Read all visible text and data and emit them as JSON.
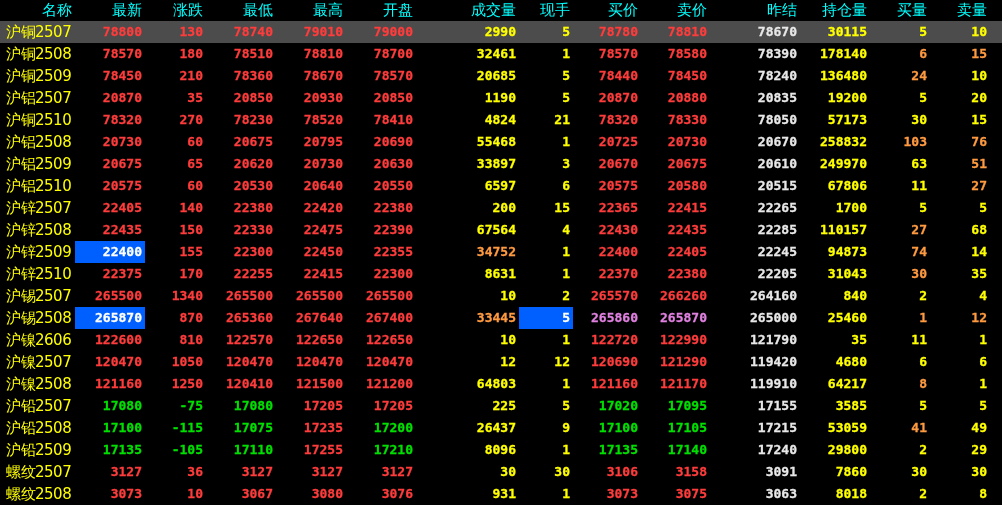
{
  "columns": [
    "名称",
    "最新",
    "涨跌",
    "最低",
    "最高",
    "开盘",
    "成交量",
    "现手",
    "买价",
    "卖价",
    "昨结",
    "持仓量",
    "买量",
    "卖量"
  ],
  "rows": [
    {
      "name": "沪铜2507",
      "selected": true,
      "cells": [
        {
          "text": "78800",
          "color": "#ff3c3c",
          "flash": false
        },
        {
          "text": "130",
          "color": "#ff3c3c",
          "flash": false
        },
        {
          "text": "78740",
          "color": "#ff3c3c",
          "flash": false
        },
        {
          "text": "79010",
          "color": "#ff3c3c",
          "flash": false
        },
        {
          "text": "79000",
          "color": "#ff3c3c",
          "flash": false
        },
        {
          "text": "2990",
          "color": "#ffff00",
          "flash": false
        },
        {
          "text": "5",
          "color": "#ffff00",
          "flash": false
        },
        {
          "text": "78780",
          "color": "#ff3c3c",
          "flash": false
        },
        {
          "text": "78810",
          "color": "#ff3c3c",
          "flash": false
        },
        {
          "text": "78670",
          "color": "#e8e8e8",
          "flash": false
        },
        {
          "text": "30115",
          "color": "#ffff00",
          "flash": false
        },
        {
          "text": "5",
          "color": "#ffff00",
          "flash": false
        },
        {
          "text": "10",
          "color": "#ffff00",
          "flash": false
        }
      ]
    },
    {
      "name": "沪铜2508",
      "selected": false,
      "cells": [
        {
          "text": "78570",
          "color": "#ff3c3c",
          "flash": false
        },
        {
          "text": "180",
          "color": "#ff3c3c",
          "flash": false
        },
        {
          "text": "78510",
          "color": "#ff3c3c",
          "flash": false
        },
        {
          "text": "78810",
          "color": "#ff3c3c",
          "flash": false
        },
        {
          "text": "78700",
          "color": "#ff3c3c",
          "flash": false
        },
        {
          "text": "32461",
          "color": "#ffff00",
          "flash": false
        },
        {
          "text": "1",
          "color": "#ffff00",
          "flash": false
        },
        {
          "text": "78570",
          "color": "#ff3c3c",
          "flash": false
        },
        {
          "text": "78580",
          "color": "#ff3c3c",
          "flash": false
        },
        {
          "text": "78390",
          "color": "#e8e8e8",
          "flash": false
        },
        {
          "text": "178140",
          "color": "#ffff00",
          "flash": false
        },
        {
          "text": "6",
          "color": "#ff9a40",
          "flash": false
        },
        {
          "text": "15",
          "color": "#ff9a40",
          "flash": false
        }
      ]
    },
    {
      "name": "沪铜2509",
      "selected": false,
      "cells": [
        {
          "text": "78450",
          "color": "#ff3c3c",
          "flash": false
        },
        {
          "text": "210",
          "color": "#ff3c3c",
          "flash": false
        },
        {
          "text": "78360",
          "color": "#ff3c3c",
          "flash": false
        },
        {
          "text": "78670",
          "color": "#ff3c3c",
          "flash": false
        },
        {
          "text": "78570",
          "color": "#ff3c3c",
          "flash": false
        },
        {
          "text": "20685",
          "color": "#ffff00",
          "flash": false
        },
        {
          "text": "5",
          "color": "#ffff00",
          "flash": false
        },
        {
          "text": "78440",
          "color": "#ff3c3c",
          "flash": false
        },
        {
          "text": "78450",
          "color": "#ff3c3c",
          "flash": false
        },
        {
          "text": "78240",
          "color": "#e8e8e8",
          "flash": false
        },
        {
          "text": "136480",
          "color": "#ffff00",
          "flash": false
        },
        {
          "text": "24",
          "color": "#ff9a40",
          "flash": false
        },
        {
          "text": "10",
          "color": "#ffff00",
          "flash": false
        }
      ]
    },
    {
      "name": "沪铝2507",
      "selected": false,
      "cells": [
        {
          "text": "20870",
          "color": "#ff3c3c",
          "flash": false
        },
        {
          "text": "35",
          "color": "#ff3c3c",
          "flash": false
        },
        {
          "text": "20850",
          "color": "#ff3c3c",
          "flash": false
        },
        {
          "text": "20930",
          "color": "#ff3c3c",
          "flash": false
        },
        {
          "text": "20850",
          "color": "#ff3c3c",
          "flash": false
        },
        {
          "text": "1190",
          "color": "#ffff00",
          "flash": false
        },
        {
          "text": "5",
          "color": "#ffff00",
          "flash": false
        },
        {
          "text": "20870",
          "color": "#ff3c3c",
          "flash": false
        },
        {
          "text": "20880",
          "color": "#ff3c3c",
          "flash": false
        },
        {
          "text": "20835",
          "color": "#e8e8e8",
          "flash": false
        },
        {
          "text": "19200",
          "color": "#ffff00",
          "flash": false
        },
        {
          "text": "5",
          "color": "#ffff00",
          "flash": false
        },
        {
          "text": "20",
          "color": "#ffff00",
          "flash": false
        }
      ]
    },
    {
      "name": "沪铜2510",
      "selected": false,
      "cells": [
        {
          "text": "78320",
          "color": "#ff3c3c",
          "flash": false
        },
        {
          "text": "270",
          "color": "#ff3c3c",
          "flash": false
        },
        {
          "text": "78230",
          "color": "#ff3c3c",
          "flash": false
        },
        {
          "text": "78520",
          "color": "#ff3c3c",
          "flash": false
        },
        {
          "text": "78410",
          "color": "#ff3c3c",
          "flash": false
        },
        {
          "text": "4824",
          "color": "#ffff00",
          "flash": false
        },
        {
          "text": "21",
          "color": "#ffff00",
          "flash": false
        },
        {
          "text": "78320",
          "color": "#ff3c3c",
          "flash": false
        },
        {
          "text": "78330",
          "color": "#ff3c3c",
          "flash": false
        },
        {
          "text": "78050",
          "color": "#e8e8e8",
          "flash": false
        },
        {
          "text": "57173",
          "color": "#ffff00",
          "flash": false
        },
        {
          "text": "30",
          "color": "#ffff00",
          "flash": false
        },
        {
          "text": "15",
          "color": "#ffff00",
          "flash": false
        }
      ]
    },
    {
      "name": "沪铝2508",
      "selected": false,
      "cells": [
        {
          "text": "20730",
          "color": "#ff3c3c",
          "flash": false
        },
        {
          "text": "60",
          "color": "#ff3c3c",
          "flash": false
        },
        {
          "text": "20675",
          "color": "#ff3c3c",
          "flash": false
        },
        {
          "text": "20795",
          "color": "#ff3c3c",
          "flash": false
        },
        {
          "text": "20690",
          "color": "#ff3c3c",
          "flash": false
        },
        {
          "text": "55468",
          "color": "#ffff00",
          "flash": false
        },
        {
          "text": "1",
          "color": "#ffff00",
          "flash": false
        },
        {
          "text": "20725",
          "color": "#ff3c3c",
          "flash": false
        },
        {
          "text": "20730",
          "color": "#ff3c3c",
          "flash": false
        },
        {
          "text": "20670",
          "color": "#e8e8e8",
          "flash": false
        },
        {
          "text": "258832",
          "color": "#ffff00",
          "flash": false
        },
        {
          "text": "103",
          "color": "#ff9a40",
          "flash": false
        },
        {
          "text": "76",
          "color": "#ff9a40",
          "flash": false
        }
      ]
    },
    {
      "name": "沪铝2509",
      "selected": false,
      "cells": [
        {
          "text": "20675",
          "color": "#ff3c3c",
          "flash": false
        },
        {
          "text": "65",
          "color": "#ff3c3c",
          "flash": false
        },
        {
          "text": "20620",
          "color": "#ff3c3c",
          "flash": false
        },
        {
          "text": "20730",
          "color": "#ff3c3c",
          "flash": false
        },
        {
          "text": "20630",
          "color": "#ff3c3c",
          "flash": false
        },
        {
          "text": "33897",
          "color": "#ffff00",
          "flash": false
        },
        {
          "text": "3",
          "color": "#ffff00",
          "flash": false
        },
        {
          "text": "20670",
          "color": "#ff3c3c",
          "flash": false
        },
        {
          "text": "20675",
          "color": "#ff3c3c",
          "flash": false
        },
        {
          "text": "20610",
          "color": "#e8e8e8",
          "flash": false
        },
        {
          "text": "249970",
          "color": "#ffff00",
          "flash": false
        },
        {
          "text": "63",
          "color": "#ffff00",
          "flash": false
        },
        {
          "text": "51",
          "color": "#ff9a40",
          "flash": false
        }
      ]
    },
    {
      "name": "沪铝2510",
      "selected": false,
      "cells": [
        {
          "text": "20575",
          "color": "#ff3c3c",
          "flash": false
        },
        {
          "text": "60",
          "color": "#ff3c3c",
          "flash": false
        },
        {
          "text": "20530",
          "color": "#ff3c3c",
          "flash": false
        },
        {
          "text": "20640",
          "color": "#ff3c3c",
          "flash": false
        },
        {
          "text": "20550",
          "color": "#ff3c3c",
          "flash": false
        },
        {
          "text": "6597",
          "color": "#ffff00",
          "flash": false
        },
        {
          "text": "6",
          "color": "#ffff00",
          "flash": false
        },
        {
          "text": "20575",
          "color": "#ff3c3c",
          "flash": false
        },
        {
          "text": "20580",
          "color": "#ff3c3c",
          "flash": false
        },
        {
          "text": "20515",
          "color": "#e8e8e8",
          "flash": false
        },
        {
          "text": "67806",
          "color": "#ffff00",
          "flash": false
        },
        {
          "text": "11",
          "color": "#ffff00",
          "flash": false
        },
        {
          "text": "27",
          "color": "#ff9a40",
          "flash": false
        }
      ]
    },
    {
      "name": "沪锌2507",
      "selected": false,
      "cells": [
        {
          "text": "22405",
          "color": "#ff3c3c",
          "flash": false
        },
        {
          "text": "140",
          "color": "#ff3c3c",
          "flash": false
        },
        {
          "text": "22380",
          "color": "#ff3c3c",
          "flash": false
        },
        {
          "text": "22420",
          "color": "#ff3c3c",
          "flash": false
        },
        {
          "text": "22380",
          "color": "#ff3c3c",
          "flash": false
        },
        {
          "text": "200",
          "color": "#ffff00",
          "flash": false
        },
        {
          "text": "15",
          "color": "#ffff00",
          "flash": false
        },
        {
          "text": "22365",
          "color": "#ff3c3c",
          "flash": false
        },
        {
          "text": "22415",
          "color": "#ff3c3c",
          "flash": false
        },
        {
          "text": "22265",
          "color": "#e8e8e8",
          "flash": false
        },
        {
          "text": "1700",
          "color": "#ffff00",
          "flash": false
        },
        {
          "text": "5",
          "color": "#ffff00",
          "flash": false
        },
        {
          "text": "5",
          "color": "#ffff00",
          "flash": false
        }
      ]
    },
    {
      "name": "沪锌2508",
      "selected": false,
      "cells": [
        {
          "text": "22435",
          "color": "#ff3c3c",
          "flash": false
        },
        {
          "text": "150",
          "color": "#ff3c3c",
          "flash": false
        },
        {
          "text": "22330",
          "color": "#ff3c3c",
          "flash": false
        },
        {
          "text": "22475",
          "color": "#ff3c3c",
          "flash": false
        },
        {
          "text": "22390",
          "color": "#ff3c3c",
          "flash": false
        },
        {
          "text": "67564",
          "color": "#ffff00",
          "flash": false
        },
        {
          "text": "4",
          "color": "#ffff00",
          "flash": false
        },
        {
          "text": "22430",
          "color": "#ff3c3c",
          "flash": false
        },
        {
          "text": "22435",
          "color": "#ff3c3c",
          "flash": false
        },
        {
          "text": "22285",
          "color": "#e8e8e8",
          "flash": false
        },
        {
          "text": "110157",
          "color": "#ffff00",
          "flash": false
        },
        {
          "text": "27",
          "color": "#ff9a40",
          "flash": false
        },
        {
          "text": "68",
          "color": "#ffff00",
          "flash": false
        }
      ]
    },
    {
      "name": "沪锌2509",
      "selected": false,
      "cells": [
        {
          "text": "22400",
          "color": "#ffffff",
          "flash": true
        },
        {
          "text": "155",
          "color": "#ff3c3c",
          "flash": false
        },
        {
          "text": "22300",
          "color": "#ff3c3c",
          "flash": false
        },
        {
          "text": "22450",
          "color": "#ff3c3c",
          "flash": false
        },
        {
          "text": "22355",
          "color": "#ff3c3c",
          "flash": false
        },
        {
          "text": "34752",
          "color": "#ff9a40",
          "flash": false
        },
        {
          "text": "1",
          "color": "#ffff00",
          "flash": false
        },
        {
          "text": "22400",
          "color": "#ff3c3c",
          "flash": false
        },
        {
          "text": "22405",
          "color": "#ff3c3c",
          "flash": false
        },
        {
          "text": "22245",
          "color": "#e8e8e8",
          "flash": false
        },
        {
          "text": "94873",
          "color": "#ffff00",
          "flash": false
        },
        {
          "text": "74",
          "color": "#ff9a40",
          "flash": false
        },
        {
          "text": "14",
          "color": "#ffff00",
          "flash": false
        }
      ]
    },
    {
      "name": "沪锌2510",
      "selected": false,
      "cells": [
        {
          "text": "22375",
          "color": "#ff3c3c",
          "flash": false
        },
        {
          "text": "170",
          "color": "#ff3c3c",
          "flash": false
        },
        {
          "text": "22255",
          "color": "#ff3c3c",
          "flash": false
        },
        {
          "text": "22415",
          "color": "#ff3c3c",
          "flash": false
        },
        {
          "text": "22300",
          "color": "#ff3c3c",
          "flash": false
        },
        {
          "text": "8631",
          "color": "#ffff00",
          "flash": false
        },
        {
          "text": "1",
          "color": "#ffff00",
          "flash": false
        },
        {
          "text": "22370",
          "color": "#ff3c3c",
          "flash": false
        },
        {
          "text": "22380",
          "color": "#ff3c3c",
          "flash": false
        },
        {
          "text": "22205",
          "color": "#e8e8e8",
          "flash": false
        },
        {
          "text": "31043",
          "color": "#ffff00",
          "flash": false
        },
        {
          "text": "30",
          "color": "#ff9a40",
          "flash": false
        },
        {
          "text": "35",
          "color": "#ffff00",
          "flash": false
        }
      ]
    },
    {
      "name": "沪锡2507",
      "selected": false,
      "cells": [
        {
          "text": "265500",
          "color": "#ff3c3c",
          "flash": false
        },
        {
          "text": "1340",
          "color": "#ff3c3c",
          "flash": false
        },
        {
          "text": "265500",
          "color": "#ff3c3c",
          "flash": false
        },
        {
          "text": "265500",
          "color": "#ff3c3c",
          "flash": false
        },
        {
          "text": "265500",
          "color": "#ff3c3c",
          "flash": false
        },
        {
          "text": "10",
          "color": "#ffff00",
          "flash": false
        },
        {
          "text": "2",
          "color": "#ffff00",
          "flash": false
        },
        {
          "text": "265570",
          "color": "#ff3c3c",
          "flash": false
        },
        {
          "text": "266260",
          "color": "#ff3c3c",
          "flash": false
        },
        {
          "text": "264160",
          "color": "#e8e8e8",
          "flash": false
        },
        {
          "text": "840",
          "color": "#ffff00",
          "flash": false
        },
        {
          "text": "2",
          "color": "#ffff00",
          "flash": false
        },
        {
          "text": "4",
          "color": "#ffff00",
          "flash": false
        }
      ]
    },
    {
      "name": "沪锡2508",
      "selected": false,
      "cells": [
        {
          "text": "265870",
          "color": "#ffffff",
          "flash": true
        },
        {
          "text": "870",
          "color": "#ff3c3c",
          "flash": false
        },
        {
          "text": "265360",
          "color": "#ff3c3c",
          "flash": false
        },
        {
          "text": "267640",
          "color": "#ff3c3c",
          "flash": false
        },
        {
          "text": "267400",
          "color": "#ff3c3c",
          "flash": false
        },
        {
          "text": "33445",
          "color": "#ff9a40",
          "flash": false
        },
        {
          "text": "5",
          "color": "#ffffff",
          "flash": true
        },
        {
          "text": "265860",
          "color": "#e080e0",
          "flash": false
        },
        {
          "text": "265870",
          "color": "#e080e0",
          "flash": false
        },
        {
          "text": "265000",
          "color": "#e8e8e8",
          "flash": false
        },
        {
          "text": "25460",
          "color": "#ffff00",
          "flash": false
        },
        {
          "text": "1",
          "color": "#ff9a40",
          "flash": false
        },
        {
          "text": "12",
          "color": "#ff9a40",
          "flash": false
        }
      ]
    },
    {
      "name": "沪镍2606",
      "selected": false,
      "cells": [
        {
          "text": "122600",
          "color": "#ff3c3c",
          "flash": false
        },
        {
          "text": "810",
          "color": "#ff3c3c",
          "flash": false
        },
        {
          "text": "122570",
          "color": "#ff3c3c",
          "flash": false
        },
        {
          "text": "122650",
          "color": "#ff3c3c",
          "flash": false
        },
        {
          "text": "122650",
          "color": "#ff3c3c",
          "flash": false
        },
        {
          "text": "10",
          "color": "#ffff00",
          "flash": false
        },
        {
          "text": "1",
          "color": "#ffff00",
          "flash": false
        },
        {
          "text": "122720",
          "color": "#ff3c3c",
          "flash": false
        },
        {
          "text": "122990",
          "color": "#ff3c3c",
          "flash": false
        },
        {
          "text": "121790",
          "color": "#e8e8e8",
          "flash": false
        },
        {
          "text": "35",
          "color": "#ffff00",
          "flash": false
        },
        {
          "text": "11",
          "color": "#ffff00",
          "flash": false
        },
        {
          "text": "1",
          "color": "#ffff00",
          "flash": false
        }
      ]
    },
    {
      "name": "沪镍2507",
      "selected": false,
      "cells": [
        {
          "text": "120470",
          "color": "#ff3c3c",
          "flash": false
        },
        {
          "text": "1050",
          "color": "#ff3c3c",
          "flash": false
        },
        {
          "text": "120470",
          "color": "#ff3c3c",
          "flash": false
        },
        {
          "text": "120470",
          "color": "#ff3c3c",
          "flash": false
        },
        {
          "text": "120470",
          "color": "#ff3c3c",
          "flash": false
        },
        {
          "text": "12",
          "color": "#ffff00",
          "flash": false
        },
        {
          "text": "12",
          "color": "#ffff00",
          "flash": false
        },
        {
          "text": "120690",
          "color": "#ff3c3c",
          "flash": false
        },
        {
          "text": "121290",
          "color": "#ff3c3c",
          "flash": false
        },
        {
          "text": "119420",
          "color": "#e8e8e8",
          "flash": false
        },
        {
          "text": "4680",
          "color": "#ffff00",
          "flash": false
        },
        {
          "text": "6",
          "color": "#ffff00",
          "flash": false
        },
        {
          "text": "6",
          "color": "#ffff00",
          "flash": false
        }
      ]
    },
    {
      "name": "沪镍2508",
      "selected": false,
      "cells": [
        {
          "text": "121160",
          "color": "#ff3c3c",
          "flash": false
        },
        {
          "text": "1250",
          "color": "#ff3c3c",
          "flash": false
        },
        {
          "text": "120410",
          "color": "#ff3c3c",
          "flash": false
        },
        {
          "text": "121500",
          "color": "#ff3c3c",
          "flash": false
        },
        {
          "text": "121200",
          "color": "#ff3c3c",
          "flash": false
        },
        {
          "text": "64803",
          "color": "#ffff00",
          "flash": false
        },
        {
          "text": "1",
          "color": "#ffff00",
          "flash": false
        },
        {
          "text": "121160",
          "color": "#ff3c3c",
          "flash": false
        },
        {
          "text": "121170",
          "color": "#ff3c3c",
          "flash": false
        },
        {
          "text": "119910",
          "color": "#e8e8e8",
          "flash": false
        },
        {
          "text": "64217",
          "color": "#ffff00",
          "flash": false
        },
        {
          "text": "8",
          "color": "#ff9a40",
          "flash": false
        },
        {
          "text": "1",
          "color": "#ffff00",
          "flash": false
        }
      ]
    },
    {
      "name": "沪铅2507",
      "selected": false,
      "cells": [
        {
          "text": "17080",
          "color": "#00e000",
          "flash": false
        },
        {
          "text": "-75",
          "color": "#00e000",
          "flash": false
        },
        {
          "text": "17080",
          "color": "#00e000",
          "flash": false
        },
        {
          "text": "17205",
          "color": "#ff3c3c",
          "flash": false
        },
        {
          "text": "17205",
          "color": "#ff3c3c",
          "flash": false
        },
        {
          "text": "225",
          "color": "#ffff00",
          "flash": false
        },
        {
          "text": "5",
          "color": "#ffff00",
          "flash": false
        },
        {
          "text": "17020",
          "color": "#00e000",
          "flash": false
        },
        {
          "text": "17095",
          "color": "#00e000",
          "flash": false
        },
        {
          "text": "17155",
          "color": "#e8e8e8",
          "flash": false
        },
        {
          "text": "3585",
          "color": "#ffff00",
          "flash": false
        },
        {
          "text": "5",
          "color": "#ffff00",
          "flash": false
        },
        {
          "text": "5",
          "color": "#ffff00",
          "flash": false
        }
      ]
    },
    {
      "name": "沪铅2508",
      "selected": false,
      "cells": [
        {
          "text": "17100",
          "color": "#00e000",
          "flash": false
        },
        {
          "text": "-115",
          "color": "#00e000",
          "flash": false
        },
        {
          "text": "17075",
          "color": "#00e000",
          "flash": false
        },
        {
          "text": "17235",
          "color": "#ff3c3c",
          "flash": false
        },
        {
          "text": "17200",
          "color": "#00e000",
          "flash": false
        },
        {
          "text": "26437",
          "color": "#ffff00",
          "flash": false
        },
        {
          "text": "9",
          "color": "#ffff00",
          "flash": false
        },
        {
          "text": "17100",
          "color": "#00e000",
          "flash": false
        },
        {
          "text": "17105",
          "color": "#00e000",
          "flash": false
        },
        {
          "text": "17215",
          "color": "#e8e8e8",
          "flash": false
        },
        {
          "text": "53059",
          "color": "#ffff00",
          "flash": false
        },
        {
          "text": "41",
          "color": "#ff9a40",
          "flash": false
        },
        {
          "text": "49",
          "color": "#ffff00",
          "flash": false
        }
      ]
    },
    {
      "name": "沪铅2509",
      "selected": false,
      "cells": [
        {
          "text": "17135",
          "color": "#00e000",
          "flash": false
        },
        {
          "text": "-105",
          "color": "#00e000",
          "flash": false
        },
        {
          "text": "17110",
          "color": "#00e000",
          "flash": false
        },
        {
          "text": "17255",
          "color": "#ff3c3c",
          "flash": false
        },
        {
          "text": "17210",
          "color": "#00e000",
          "flash": false
        },
        {
          "text": "8096",
          "color": "#ffff00",
          "flash": false
        },
        {
          "text": "1",
          "color": "#ffff00",
          "flash": false
        },
        {
          "text": "17135",
          "color": "#00e000",
          "flash": false
        },
        {
          "text": "17140",
          "color": "#00e000",
          "flash": false
        },
        {
          "text": "17240",
          "color": "#e8e8e8",
          "flash": false
        },
        {
          "text": "29800",
          "color": "#ffff00",
          "flash": false
        },
        {
          "text": "2",
          "color": "#ffff00",
          "flash": false
        },
        {
          "text": "29",
          "color": "#ffff00",
          "flash": false
        }
      ]
    },
    {
      "name": "螺纹2507",
      "selected": false,
      "cells": [
        {
          "text": "3127",
          "color": "#ff3c3c",
          "flash": false
        },
        {
          "text": "36",
          "color": "#ff3c3c",
          "flash": false
        },
        {
          "text": "3127",
          "color": "#ff3c3c",
          "flash": false
        },
        {
          "text": "3127",
          "color": "#ff3c3c",
          "flash": false
        },
        {
          "text": "3127",
          "color": "#ff3c3c",
          "flash": false
        },
        {
          "text": "30",
          "color": "#ffff00",
          "flash": false
        },
        {
          "text": "30",
          "color": "#ffff00",
          "flash": false
        },
        {
          "text": "3106",
          "color": "#ff3c3c",
          "flash": false
        },
        {
          "text": "3158",
          "color": "#ff3c3c",
          "flash": false
        },
        {
          "text": "3091",
          "color": "#e8e8e8",
          "flash": false
        },
        {
          "text": "7860",
          "color": "#ffff00",
          "flash": false
        },
        {
          "text": "30",
          "color": "#ffff00",
          "flash": false
        },
        {
          "text": "30",
          "color": "#ffff00",
          "flash": false
        }
      ]
    },
    {
      "name": "螺纹2508",
      "selected": false,
      "cells": [
        {
          "text": "3073",
          "color": "#ff3c3c",
          "flash": false
        },
        {
          "text": "10",
          "color": "#ff3c3c",
          "flash": false
        },
        {
          "text": "3067",
          "color": "#ff3c3c",
          "flash": false
        },
        {
          "text": "3080",
          "color": "#ff3c3c",
          "flash": false
        },
        {
          "text": "3076",
          "color": "#ff3c3c",
          "flash": false
        },
        {
          "text": "931",
          "color": "#ffff00",
          "flash": false
        },
        {
          "text": "1",
          "color": "#ffff00",
          "flash": false
        },
        {
          "text": "3073",
          "color": "#ff3c3c",
          "flash": false
        },
        {
          "text": "3075",
          "color": "#ff3c3c",
          "flash": false
        },
        {
          "text": "3063",
          "color": "#e8e8e8",
          "flash": false
        },
        {
          "text": "8018",
          "color": "#ffff00",
          "flash": false
        },
        {
          "text": "2",
          "color": "#ffff00",
          "flash": false
        },
        {
          "text": "8",
          "color": "#ffff00",
          "flash": false
        }
      ]
    }
  ]
}
